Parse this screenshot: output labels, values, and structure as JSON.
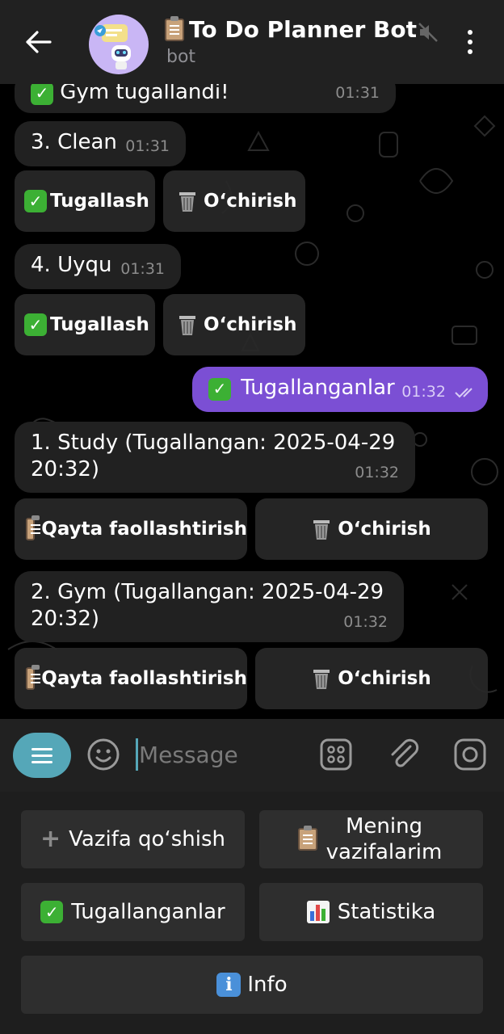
{
  "header": {
    "title": "To Do Planner Bot",
    "subtitle": "bot",
    "title_icon": "clipboard-icon"
  },
  "messages": [
    {
      "text": "Gym tugallandi!",
      "time": "01:31",
      "icon": "check-mark-icon"
    },
    {
      "text": "3. Clean",
      "time": "01:31"
    },
    {
      "text": "4. Uyqu",
      "time": "01:31"
    },
    {
      "text": "Tugallanganlar",
      "time": "01:32",
      "outgoing": true,
      "icon": "check-mark-icon"
    },
    {
      "text": "1. Study (Tugallangan: 2025-04-29 20:32)",
      "time": "01:32"
    },
    {
      "text": "2. Gym (Tugallangan: 2025-04-29 20:32)",
      "time": "01:32"
    }
  ],
  "inline_buttons": {
    "complete": "Tugallash",
    "delete": "O‘chirish",
    "reactivate": "Qayta faollashtirish"
  },
  "input": {
    "placeholder": "Message"
  },
  "reply_keyboard": {
    "add_task": "Vazifa qo‘shish",
    "my_tasks": "Mening vazifalarim",
    "completed": "Tugallanganlar",
    "stats": "Statistika",
    "info": "Info"
  },
  "colors": {
    "accent": "#55a7b8",
    "outgoing_bubble": "#7b4fd4",
    "incoming_bubble": "#212121",
    "check_green": "#3cb034"
  }
}
